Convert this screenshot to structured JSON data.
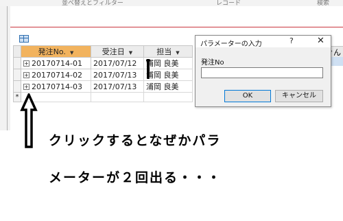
{
  "top_strip": {
    "frag1": "並べ替えとフィルター",
    "frag2": "レコード",
    "frag3": "検索"
  },
  "datasheet": {
    "columns": [
      "発注No.",
      "受注日",
      "担当",
      "ぐん"
    ],
    "rows": [
      {
        "order_no": "20170714-01",
        "date": "2017/07/12",
        "staff": "浦岡 良美"
      },
      {
        "order_no": "20170714-02",
        "date": "2017/07/13",
        "staff": "浦岡 良美"
      },
      {
        "order_no": "20170714-03",
        "date": "2017/07/13",
        "staff": "浦岡 良美"
      }
    ],
    "new_row_marker": "*",
    "expand_glyph": "+"
  },
  "dialog": {
    "title": "パラメーターの入力",
    "help": "?",
    "close": "✕",
    "prompt_label": "発注No",
    "input_value": "",
    "ok_label": "OK",
    "cancel_label": "キャンセル"
  },
  "caption": {
    "line1": "クリックするとなぜかパラ",
    "line2": "メーターが２回出る・・・"
  },
  "colors": {
    "selected_header": "#f2b35e",
    "row_highlight": "#cfe0f3",
    "accent_red": "#c9353d",
    "ok_border": "#0078d7"
  }
}
